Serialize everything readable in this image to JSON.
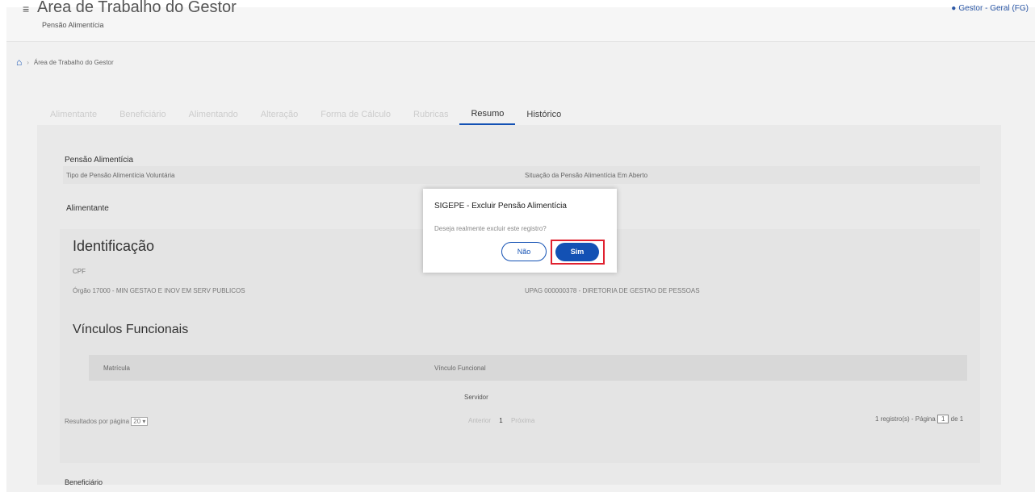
{
  "header": {
    "title": "Área de Trabalho do Gestor",
    "subtitle": "Pensão Alimentícia",
    "user_label": "Gestor - Geral (FG)"
  },
  "breadcrumb": {
    "item": "Área de Trabalho do Gestor"
  },
  "tabs": [
    {
      "label": "Alimentante"
    },
    {
      "label": "Beneficiário"
    },
    {
      "label": "Alimentando"
    },
    {
      "label": "Alteração"
    },
    {
      "label": "Forma de Cálculo"
    },
    {
      "label": "Rubricas"
    },
    {
      "label": "Resumo"
    },
    {
      "label": "Histórico"
    }
  ],
  "resumo": {
    "pensao_title": "Pensão Alimentícia",
    "tipo_label": "Tipo de Pensão Alimentícia Voluntária",
    "situacao_label": "Situação da Pensão Alimentícia Em Aberto",
    "alimentante_title": "Alimentante",
    "identificacao_title": "Identificação",
    "cpf_label": "CPF",
    "orgao_label": "Órgão 17000 - MIN GESTAO E INOV EM SERV PUBLICOS",
    "upag_label": "UPAG 000000378 - DIRETORIA DE GESTAO DE PESSOAS",
    "vinculos_title": "Vínculos Funcionais",
    "col_matricula": "Matrícula",
    "col_vinculo": "Vínculo Funcional",
    "row_vinculo": "Servidor",
    "resultados_label": "Resultados por página",
    "resultados_value": "20",
    "prev_label": "Anterior",
    "page_current": "1",
    "next_label": "Próxima",
    "registros_label": "1 registro(s) - Página",
    "page_input": "1",
    "page_total": "de 1",
    "beneficiario_title": "Beneficiário"
  },
  "modal": {
    "title": "SIGEPE - Excluir Pensão Alimentícia",
    "message": "Deseja realmente excluir este registro?",
    "no_label": "Não",
    "yes_label": "Sim"
  }
}
